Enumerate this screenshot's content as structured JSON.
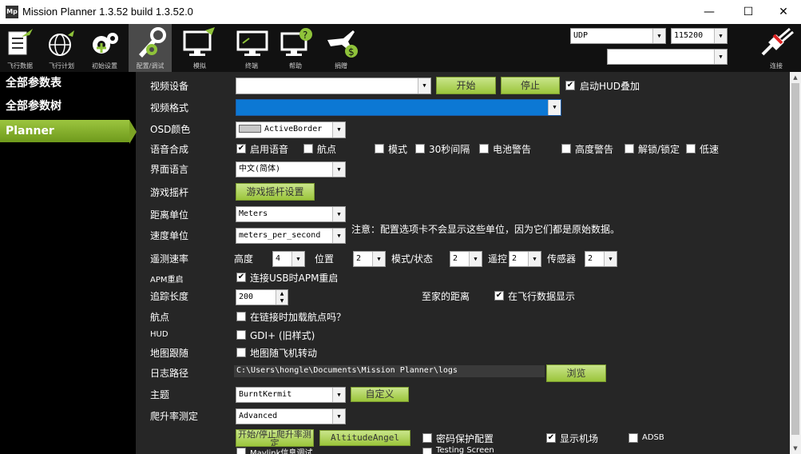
{
  "window": {
    "title": "Mission Planner 1.3.52 build 1.3.52.0",
    "icon_text": "Mp",
    "min": "—",
    "max": "☐",
    "close": "✕"
  },
  "toolbar": {
    "items": [
      {
        "label": "飞行数据",
        "icon": "flight-data-icon"
      },
      {
        "label": "飞行计划",
        "icon": "flight-plan-icon"
      },
      {
        "label": "初始设置",
        "icon": "initial-setup-icon"
      },
      {
        "label": "配置/调试",
        "icon": "config-tuning-icon"
      },
      {
        "label": "模拟",
        "icon": "simulation-icon"
      },
      {
        "label": "终端",
        "icon": "terminal-icon"
      },
      {
        "label": "帮助",
        "icon": "help-icon"
      },
      {
        "label": "捐赠",
        "icon": "donate-icon"
      }
    ],
    "connection_type": "UDP",
    "baud_rate": "115200",
    "port_extra": "",
    "connect_label": "连接"
  },
  "sidebar": {
    "items": [
      {
        "label": "全部参数表"
      },
      {
        "label": "全部参数树"
      },
      {
        "label": "Planner"
      }
    ]
  },
  "planner": {
    "video_device": {
      "label": "视频设备",
      "value": "",
      "start": "开始",
      "stop": "停止",
      "hud_overlay": "启动HUD叠加"
    },
    "video_format": {
      "label": "视频格式",
      "value": ""
    },
    "osd_color": {
      "label": "OSD颜色",
      "value": "ActiveBorder"
    },
    "speech": {
      "label": "语音合成",
      "options": [
        "启用语音",
        "航点",
        "模式",
        "30秒间隔",
        "电池警告",
        "高度警告",
        "解锁/锁定",
        "低速"
      ]
    },
    "ui_language": {
      "label": "界面语言",
      "value": "中文(简体)"
    },
    "joystick": {
      "label": "游戏摇杆",
      "button": "游戏摇杆设置"
    },
    "distance_unit": {
      "label": "距离单位",
      "value": "Meters"
    },
    "speed_unit": {
      "label": "速度单位",
      "value": "meters_per_second",
      "note": "注意：配置选项卡不会显示这些单位，因为它们都是原始数据。"
    },
    "telemetry": {
      "label": "遥测速率",
      "altitude_label": "高度",
      "altitude": "4",
      "position_label": "位置",
      "position": "2",
      "mode_label": "模式/状态",
      "mode": "2",
      "rc_label": "遥控",
      "rc": "2",
      "sensor_label": "传感器",
      "sensor": "2"
    },
    "apm_reset": {
      "label": "APM重启",
      "option": "连接USB时APM重启"
    },
    "track_length": {
      "label": "追踪长度",
      "value": "200",
      "home_distance": "至家的距离",
      "show_in_flight": "在飞行数据显示"
    },
    "waypoints": {
      "label": "航点",
      "option": "在链接时加载航点吗？"
    },
    "hud": {
      "label": "HUD",
      "option": "GDI+ (旧样式)"
    },
    "map_follow": {
      "label": "地图跟随",
      "option": "地图随飞机转动"
    },
    "log_path": {
      "label": "日志路径",
      "value": "C:\\Users\\hongle\\Documents\\Mission Planner\\logs",
      "browse": "浏览"
    },
    "theme": {
      "label": "主题",
      "value": "BurntKermit",
      "custom": "自定义"
    },
    "climb_rate": {
      "label": "爬升率测定",
      "value": "Advanced"
    },
    "bottom": {
      "start_stop_climb": "开始/停止爬升率测定",
      "altitude_angel": "AltitudeAngel",
      "password_protect": "密码保护配置",
      "show_vehicle": "显示机场",
      "adsb": "ADSB",
      "mavlink_debug": "Mavlink信息调试",
      "testing_screen": "Testing Screen"
    }
  }
}
